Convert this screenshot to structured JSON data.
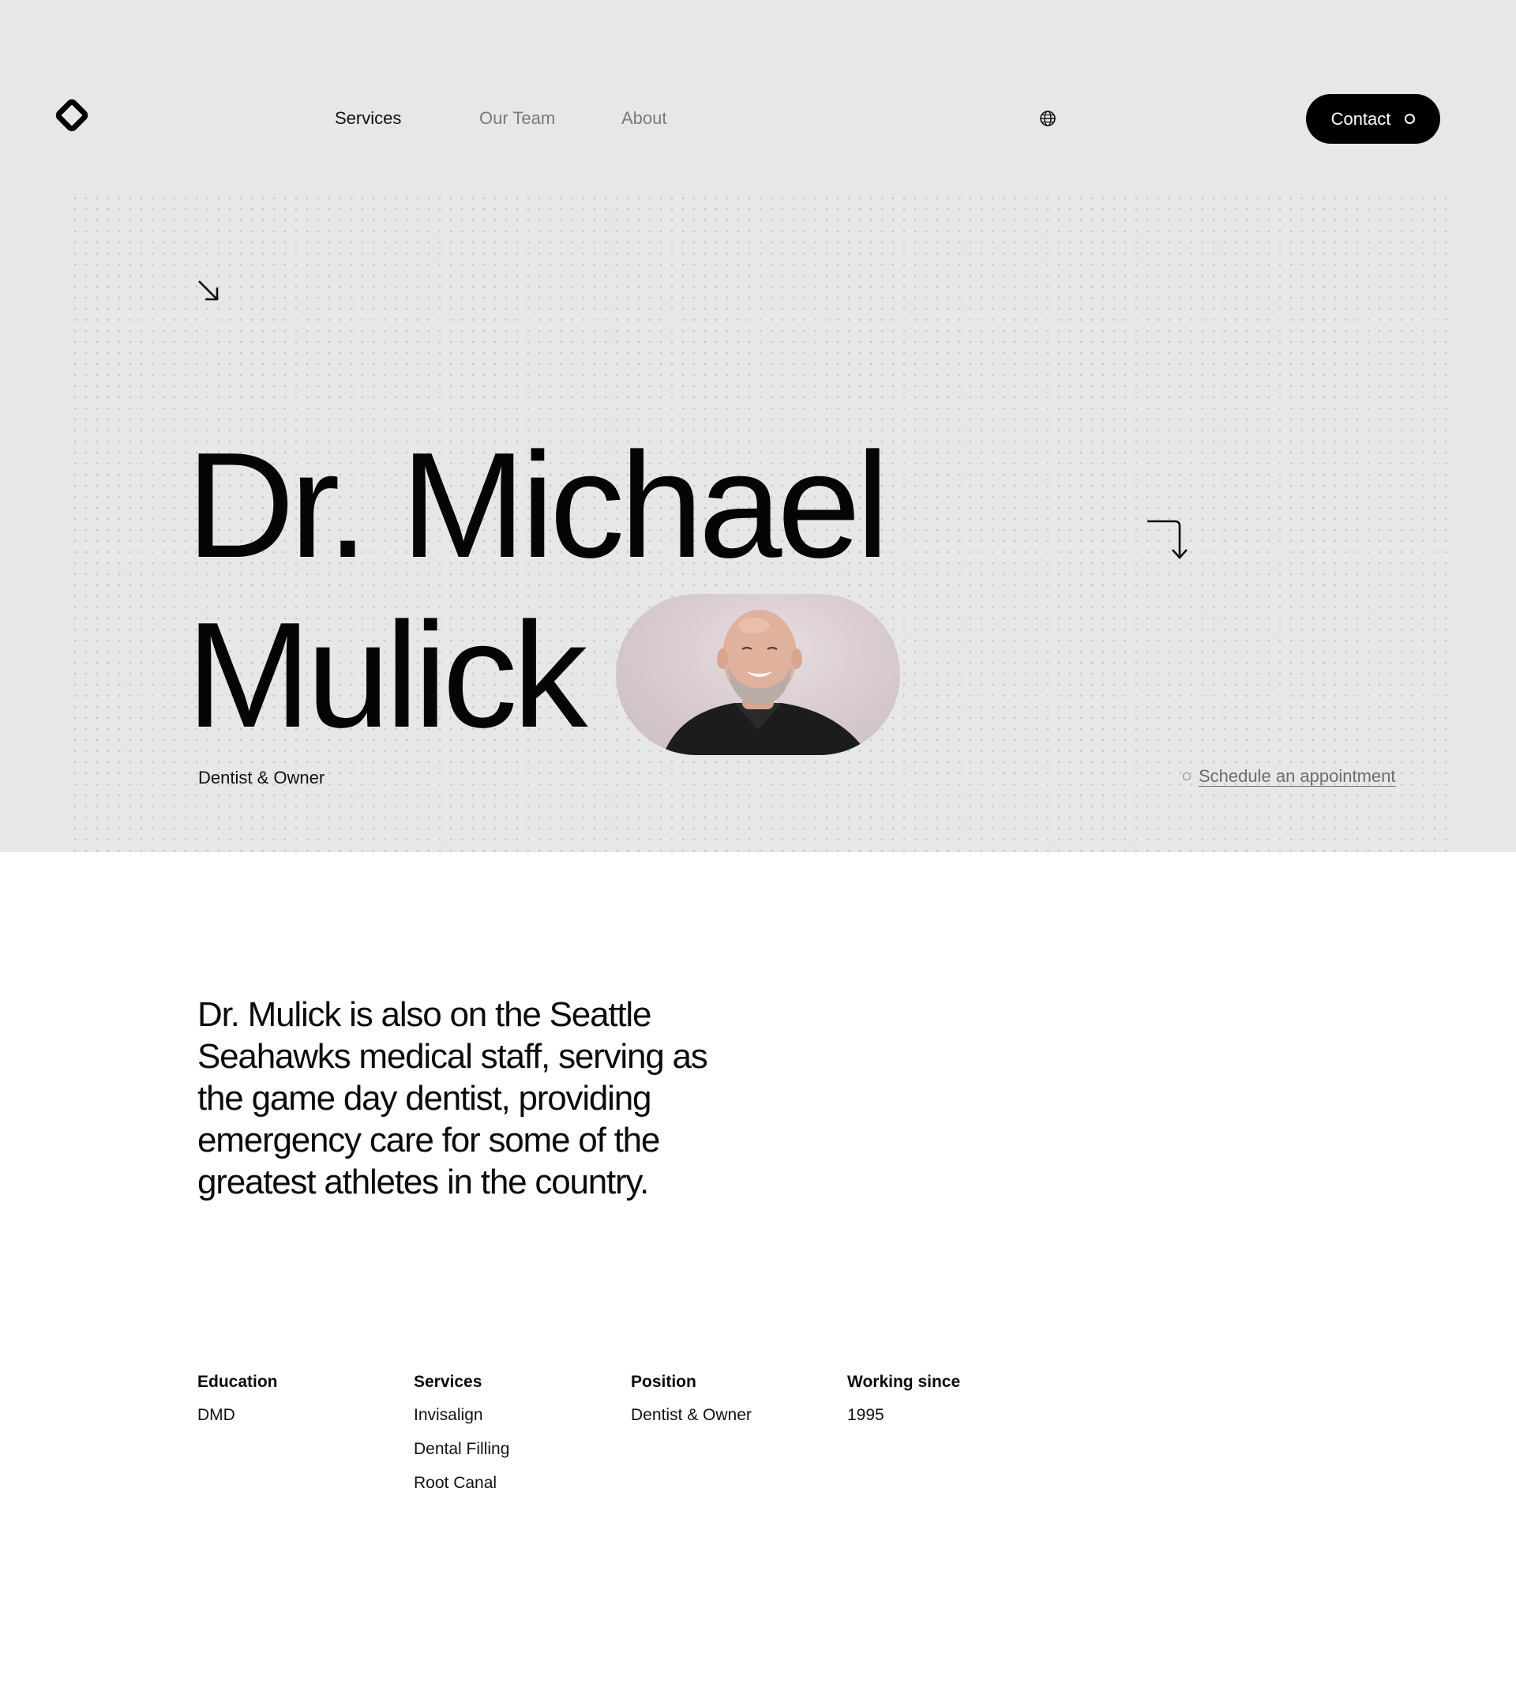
{
  "nav": {
    "links": [
      "Services",
      "Our Team",
      "About"
    ],
    "contact_label": "Contact"
  },
  "hero": {
    "name_line1": "Dr. Michael",
    "name_line2": "Mulick",
    "subtitle": "Dentist & Owner",
    "schedule_label": "Schedule an appointment"
  },
  "bio": "Dr. Mulick is also on the Seattle Seahawks medical staff, serving as the game day dentist, providing emergency care for some of the greatest athletes in the country.",
  "details": {
    "education": {
      "heading": "Education",
      "values": [
        "DMD"
      ]
    },
    "services": {
      "heading": "Services",
      "values": [
        "Invisalign",
        "Dental Filling",
        "Root Canal"
      ]
    },
    "position": {
      "heading": "Position",
      "values": [
        "Dentist & Owner"
      ]
    },
    "working_since": {
      "heading": "Working since",
      "values": [
        "1995"
      ]
    }
  },
  "icons": {
    "logo": "diamond-logo-icon",
    "globe": "globe-icon",
    "arrow": "arrow-down-right-icon",
    "turn": "turn-down-arrow-icon"
  },
  "colors": {
    "hero_bg": "#e7e7e9",
    "page_bg": "#ffffff",
    "button_bg": "#000000",
    "muted_text": "#7a7a7a"
  }
}
